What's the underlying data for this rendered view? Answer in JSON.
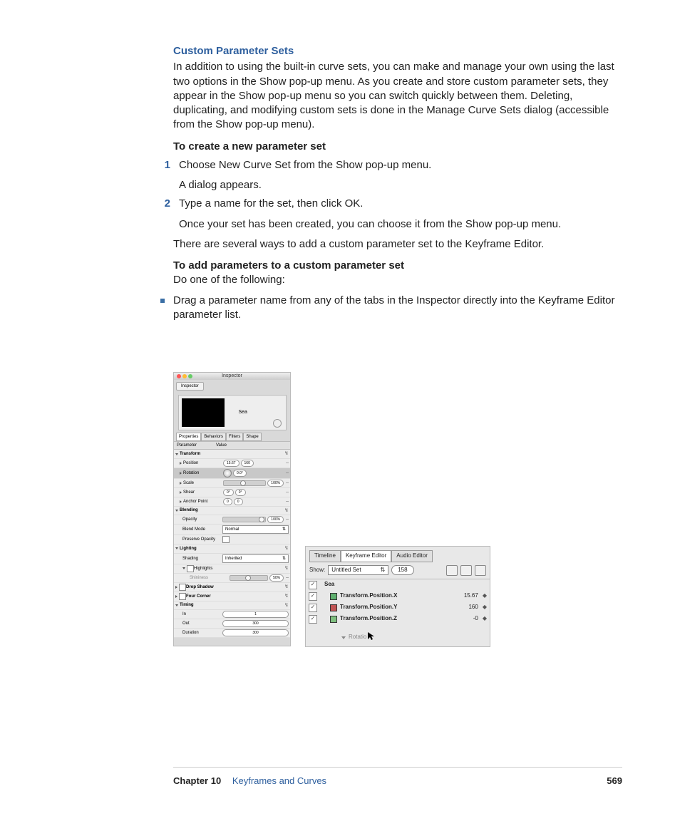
{
  "heading": "Custom Parameter Sets",
  "intro": "In addition to using the built-in curve sets, you can make and manage your own using the last two options in the Show pop-up menu. As you create and store custom parameter sets, they appear in the Show pop-up menu so you can switch quickly between them. Deleting, duplicating, and modifying custom sets is done in the Manage Curve Sets dialog (accessible from the Show pop-up menu).",
  "create_head": "To create a new parameter set",
  "steps": {
    "s1": "Choose New Curve Set from the Show pop-up menu.",
    "s1b": "A dialog appears.",
    "s2": "Type a name for the set, then click OK.",
    "s2b": "Once your set has been created, you can choose it from the Show pop-up menu."
  },
  "mid_para": "There are several ways to add a custom parameter set to the Keyframe Editor.",
  "add_head": "To add parameters to a custom parameter set",
  "add_sub": "Do one of the following:",
  "bullet": "Drag a parameter name from any of the tabs in the Inspector directly into the Keyframe Editor parameter list.",
  "inspector": {
    "title": "Inspector",
    "tab": "Inspector",
    "layer": "Sea",
    "tabs4": [
      "Properties",
      "Behaviors",
      "Filters",
      "Shape"
    ],
    "col_param": "Parameter",
    "col_value": "Value",
    "groups": {
      "transform": "Transform",
      "position": "Position",
      "rotation": "Rotation",
      "scale": "Scale",
      "shear": "Shear",
      "anchor": "Anchor Point",
      "blending": "Blending",
      "opacity": "Opacity",
      "blendmode": "Blend Mode",
      "preserve": "Preserve Opacity",
      "lighting": "Lighting",
      "shading": "Shading",
      "highlights": "Highlights",
      "shininess": "Shininess",
      "dropshadow": "Drop Shadow",
      "fourcorner": "Four Corner",
      "timing": "Timing",
      "in": "In",
      "out": "Out",
      "duration": "Duration"
    },
    "vals": {
      "posx": "15.67",
      "posy": "160",
      "rot": "0.0°",
      "scale": "100%",
      "shearx": "0°",
      "sheary": "0°",
      "anchx": "0",
      "anchy": "0",
      "opacity": "100%",
      "blendmode": "Normal",
      "shading": "Inherited",
      "shin": "50%",
      "in": "1",
      "out": "300",
      "dur": "300"
    }
  },
  "kfe": {
    "tabs": [
      "Timeline",
      "Keyframe Editor",
      "Audio Editor"
    ],
    "show_label": "Show:",
    "set_name": "Untitled Set",
    "frame": "158",
    "group": "Sea",
    "rows": [
      {
        "name": "Transform.Position.X",
        "val": "15.67",
        "color": "#5fb06f"
      },
      {
        "name": "Transform.Position.Y",
        "val": "160",
        "color": "#c25555"
      },
      {
        "name": "Transform.Position.Z",
        "val": "-0",
        "color": "#7fbf7f"
      }
    ],
    "drag_label": "Rotatio"
  },
  "footer": {
    "chapter_label": "Chapter 10",
    "chapter_title": "Keyframes and Curves",
    "page": "569"
  },
  "step_num_1": "1",
  "step_num_2": "2"
}
